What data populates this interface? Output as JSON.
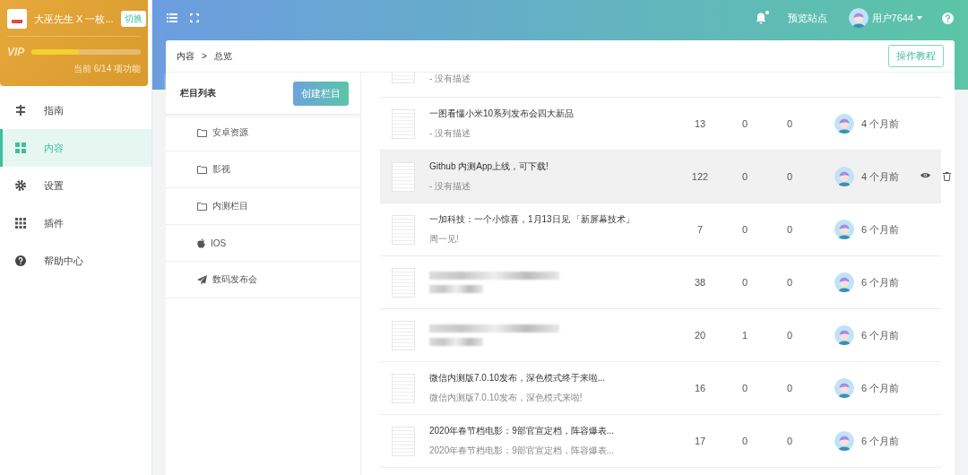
{
  "account": {
    "name": "大巫先生 X 一枚...",
    "switch": "切换",
    "vip": "VIP",
    "level": 0.43,
    "usage": "当前 6/14 项功能"
  },
  "nav": [
    {
      "label": "指南",
      "selected": false
    },
    {
      "label": "内容",
      "selected": true
    },
    {
      "label": "设置",
      "selected": false
    },
    {
      "label": "插件",
      "selected": false
    },
    {
      "label": "帮助中心",
      "selected": false
    }
  ],
  "topbar": {
    "notification": true,
    "preview": "预览站点",
    "user": "用户7644"
  },
  "breadcrumb": [
    "内容",
    "总览"
  ],
  "breadcrumb_sep": ">",
  "tutorial": "操作教程",
  "columns_panel": {
    "title": "栏目列表",
    "create": "创建栏目",
    "items": [
      {
        "label": "安卓资源",
        "kind": "folder"
      },
      {
        "label": "影视",
        "kind": "folder"
      },
      {
        "label": "内测栏目",
        "kind": "folder"
      },
      {
        "label": "IOS",
        "kind": "apple"
      },
      {
        "label": "数码发布会",
        "kind": "event"
      }
    ]
  },
  "posts": [
    {
      "kind": "partial",
      "description": "- 没有描述",
      "highlighted": false
    },
    {
      "kind": "normal",
      "title": "一图看懂小米10系列发布会四大新品",
      "description": "- 没有描述",
      "column_2": "13",
      "column_3": "0",
      "column_4": "0",
      "time": "4 个月前",
      "highlighted": false
    },
    {
      "kind": "normal",
      "title": "Github 内测App上线，可下载!",
      "description": "- 没有描述",
      "column_2": "122",
      "column_3": "0",
      "column_4": "0",
      "time": "4 个月前",
      "highlighted": true
    },
    {
      "kind": "normal",
      "title": "一加科技：一个小惊喜，1月13日见 「新屏幕技术」",
      "description": "周一见!",
      "column_2": "7",
      "column_3": "0",
      "column_4": "0",
      "time": "6 个月前",
      "highlighted": false
    },
    {
      "kind": "blurred",
      "column_2": "38",
      "column_3": "0",
      "column_4": "0",
      "time": "6 个月前",
      "highlighted": false
    },
    {
      "kind": "blurred",
      "column_2": "20",
      "column_3": "1",
      "column_4": "0",
      "time": "6 个月前",
      "highlighted": false
    },
    {
      "kind": "normal",
      "title": "微信内测版7.0.10发布，深色模式终于来啦...",
      "description": "微信内测版7.0.10发布，深色模式来啦!",
      "column_2": "16",
      "column_3": "0",
      "column_4": "0",
      "time": "6 个月前",
      "highlighted": false
    },
    {
      "kind": "normal",
      "title": "2020年春节档电影：9部官宣定档，阵容爆表...",
      "description": "2020年春节档电影：9部官宣定档，阵容爆表...",
      "column_2": "17",
      "column_3": "0",
      "column_4": "0",
      "time": "6 个月前",
      "highlighted": false
    }
  ]
}
